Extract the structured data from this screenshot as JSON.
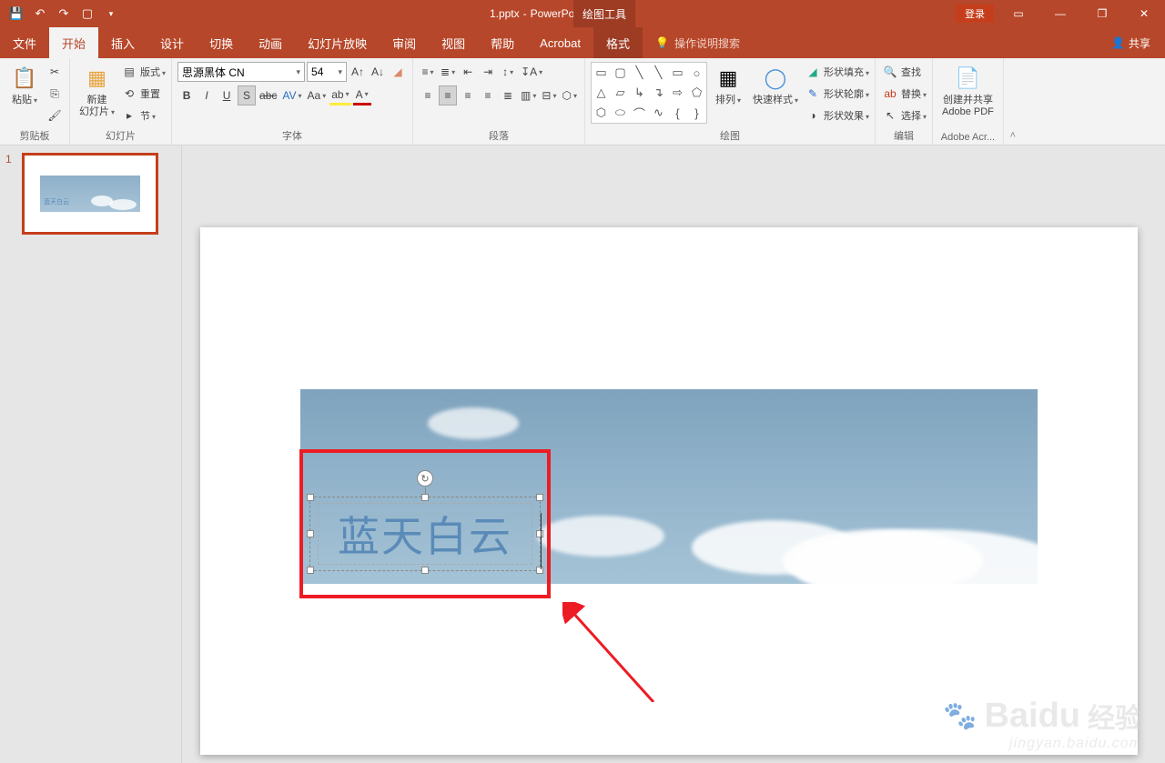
{
  "title": {
    "filename": "1.pptx",
    "app": "PowerPoint",
    "context_tool": "绘图工具"
  },
  "win": {
    "login": "登录"
  },
  "tabs": {
    "file": "文件",
    "home": "开始",
    "insert": "插入",
    "design": "设计",
    "transitions": "切换",
    "animations": "动画",
    "slideshow": "幻灯片放映",
    "review": "审阅",
    "view": "视图",
    "help": "帮助",
    "acrobat": "Acrobat",
    "format": "格式",
    "tellme": "操作说明搜索",
    "share": "共享"
  },
  "ribbon": {
    "clipboard": {
      "paste": "粘贴",
      "label": "剪贴板"
    },
    "slides": {
      "new": "新建\n幻灯片",
      "layout": "版式",
      "reset": "重置",
      "section": "节",
      "label": "幻灯片"
    },
    "font": {
      "name": "思源黑体 CN",
      "size": "54",
      "label": "字体"
    },
    "paragraph": {
      "label": "段落"
    },
    "drawing": {
      "arrange": "排列",
      "quickstyle": "快速样式",
      "fill": "形状填充",
      "outline": "形状轮廓",
      "effects": "形状效果",
      "label": "绘图"
    },
    "editing": {
      "find": "查找",
      "replace": "替换",
      "select": "选择",
      "label": "编辑"
    },
    "adobe": {
      "create": "创建并共享\nAdobe PDF",
      "label": "Adobe Acr..."
    }
  },
  "slidepanel": {
    "num": "1"
  },
  "slide": {
    "text": "蓝天白云",
    "thumb_text": "蓝天白云"
  },
  "watermark": {
    "brand": "Baidu",
    "sub": "经验",
    "url": "jingyan.baidu.com"
  }
}
